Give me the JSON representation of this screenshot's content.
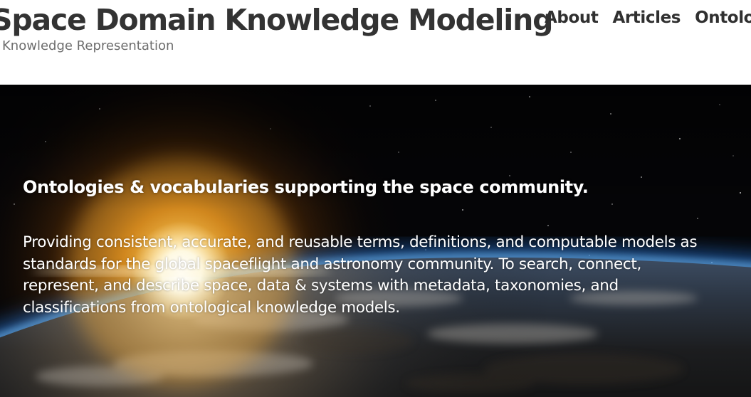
{
  "header": {
    "site_title": "Space Domain Knowledge Modeling",
    "tagline": "Knowledge Representation",
    "nav": [
      {
        "label": "About"
      },
      {
        "label": "Articles"
      },
      {
        "label": "Ontologies"
      }
    ]
  },
  "hero": {
    "heading": {
      "part1": "Ontologies",
      "part2": " & ",
      "part3": "vocabularies",
      "part4": " supporting the space community."
    },
    "paragraph": "Providing consistent, accurate, and reusable terms, definitions, and computable models as standards for the global spaceflight and astronomy community. To search, connect, represent, and describe space, data & systems with metadata, taxonomies, and classifications from ontological knowledge models.",
    "background_image": "earth-sunrise-from-space"
  },
  "colors": {
    "title_text": "#333333",
    "tagline_text": "#6d6d6d",
    "nav_text": "#303030",
    "hero_text": "#ffffff",
    "space_black": "#040406",
    "sun_glow": "#ffb338",
    "atmosphere_blue": "#2a8cff"
  }
}
